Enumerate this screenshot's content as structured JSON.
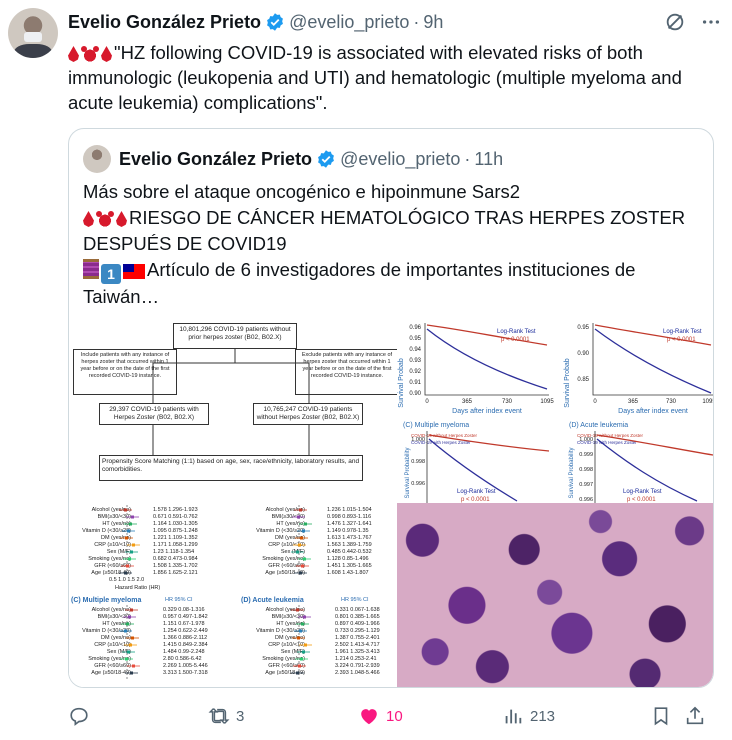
{
  "tweet": {
    "author_name": "Evelio González Prieto",
    "handle": "@evelio_prieto",
    "separator": "·",
    "time": "9h",
    "text": "\"HZ following COVID-19 is associated with elevated risks of both immunologic (leukopenia and UTI) and hematologic (multiple myeloma and acute leukemia) complications\"."
  },
  "quote": {
    "author_name": "Evelio González Prieto",
    "handle": "@evelio_prieto",
    "separator": "·",
    "time": "11h",
    "line1": "Más sobre el ataque oncogénico e hipoinmune Sars2",
    "line2": "RIESGO DE CÁNCER HEMATOLÓGICO TRAS HERPES ZOSTER DESPUÉS DE COVID19",
    "line3": "Artículo de 6 investigadores de importantes instituciones de Taiwán…"
  },
  "figure": {
    "top_box": "10,801,296 COVID-19 patients without prior herpes zoster (B02, B02.X)",
    "left_excl": "Include patients with any instance of herpes zoster that occurred within 1 year before or on the date of the first recorded COVID-19 instance.",
    "right_excl": "Exclude patients with any instance of herpes zoster that occurred within 1 year before or on the date of the first recorded COVID-19 instance.",
    "left_cohort": "29,397 COVID-19 patients with Herpes Zoster (B02, B02.X)",
    "right_cohort": "10,765,247 COVID-19 patients without Herpes Zoster (B02, B02.X)",
    "psm": "Propensity Score Matching (1:1) based on age, sex, race/ethnicity, laboratory results, and comorbidities.",
    "km1_ylabel": "Survival Probab",
    "km1_ticks": [
      "0.96",
      "0.95",
      "0.94",
      "0.93",
      "0.92",
      "0.91",
      "0.90"
    ],
    "km_test": "Log-Rank Test",
    "km_p": "p < 0.0001",
    "km_xticks": [
      "0",
      "365",
      "730",
      "1095"
    ],
    "km_xlabel": "Days after index event",
    "km2_ylabel": "Survival Probab",
    "km2_ticks": [
      "0.95",
      "0.90",
      "0.85"
    ],
    "km_mm_title": "(C) Multiple myeloma",
    "km_al_title": "(D) Acute leukemia",
    "km_legend_with": "COVID-19 with Herpes Zoster",
    "km_legend_without": "COVID-19 without Herpes Zoster",
    "km_mm_ylabel": "Survival Probability",
    "km_mm_ticks": [
      "1.000",
      "0.998",
      "0.996"
    ],
    "km_al_ticks": [
      "1.000",
      "0.999",
      "0.998",
      "0.997",
      "0.996"
    ],
    "forest_rows_a": [
      "Alcohol (yes/no)",
      "BMI(≥30/<30)",
      "HT (yes/no)",
      "Vitamin D (<30/≥20)",
      "DM (yes/no)",
      "CRP (≥10/<10)",
      "Sex (M/F)",
      "Smoking (yes/no)",
      "GFR (<60/≥60)",
      "Age (≥50/18-49)"
    ],
    "forest_vals_a": [
      "1.578 1.296-1.923",
      "0.671 0.591-0.762",
      "1.164 1.030-1.305",
      "1.095 0.875-1.248",
      "1.221 1.109-1.352",
      "1.171 1.058-1.299",
      "1.23 1.118-1.354",
      "0.682 0.473-0.984",
      "1.508 1.335-1.702",
      "1.856 1.625-2.121"
    ],
    "forest_vals_b": [
      "1.236 1.015-1.504",
      "0.998 0.893-1.116",
      "1.476 1.327-1.641",
      "1.149 0.978-1.35",
      "1.613 1.473-1.767",
      "1.563 1.389-1.759",
      "0.485 0.442-0.532",
      "1.128 0.85-1.496",
      "1.451 1.305-1.665",
      "1.608 1.43-1.807"
    ],
    "forest_axis": [
      "0.5",
      "1.0",
      "1.5",
      "2.0"
    ],
    "forest_xlabel": "Hazard Ratio (HR)",
    "forest_mm_title": "(C) Multiple myeloma",
    "forest_al_title": "(D) Acute leukemia",
    "forest_hdr_hr": "HR",
    "forest_hdr_ci": "95% CI",
    "forest_vals_c": [
      "0.329 0.08-1.316",
      "0.957 0.497-1.842",
      "1.151 0.67-1.978",
      "1.254 0.622-2.449",
      "1.366 0.886-2.112",
      "1.415 0.849-2.384",
      "1.484 0.99-2.248",
      "2.80 0.586-6.42",
      "2.269 1.005-5.446",
      "3.313 1.500-7.318"
    ],
    "forest_vals_d": [
      "0.331 0.067-1.638",
      "0.801 0.385-1.665",
      "0.897 0.409-1.966",
      "0.733 0.295-1.129",
      "1.387 0.755-2.401",
      "2.502 1.413-4.717",
      "1.961 1.325-3.413",
      "1.214 0.253-2.41",
      "3.224 0.791-2.939",
      "2.393 1.048-5.466"
    ]
  },
  "actions": {
    "reply_count": "",
    "retweet_count": "3",
    "like_count": "10",
    "views_count": "213"
  },
  "colors": {
    "like": "#f91880",
    "verified": "#1d9bf0",
    "muted": "#536471",
    "km_with": "#c0392b",
    "km_without": "#2d2f9a"
  }
}
